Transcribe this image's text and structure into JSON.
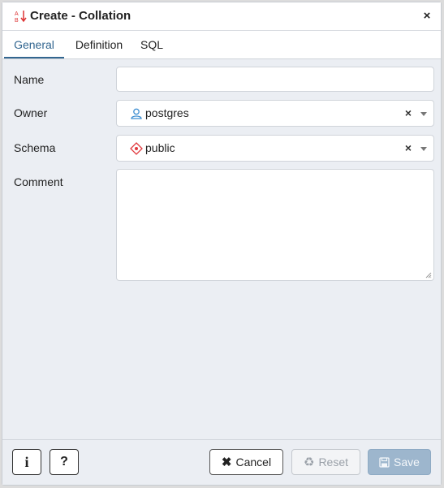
{
  "dialog": {
    "title": "Create - Collation",
    "title_icon": "collation-icon",
    "close_label": "×"
  },
  "tabs": [
    {
      "label": "General",
      "active": true
    },
    {
      "label": "Definition",
      "active": false
    },
    {
      "label": "SQL",
      "active": false
    }
  ],
  "form": {
    "name": {
      "label": "Name",
      "value": ""
    },
    "owner": {
      "label": "Owner",
      "value": "postgres",
      "icon": "user-icon"
    },
    "schema": {
      "label": "Schema",
      "value": "public",
      "icon": "schema-icon"
    },
    "comment": {
      "label": "Comment",
      "value": ""
    }
  },
  "footer": {
    "info_label": "i",
    "help_label": "?",
    "cancel_label": "Cancel",
    "reset_label": "Reset",
    "save_label": "Save"
  },
  "colors": {
    "accent": "#326690",
    "save_disabled": "#9db6cd",
    "schema_icon": "#e0393e",
    "user_icon": "#3f8fd2"
  }
}
